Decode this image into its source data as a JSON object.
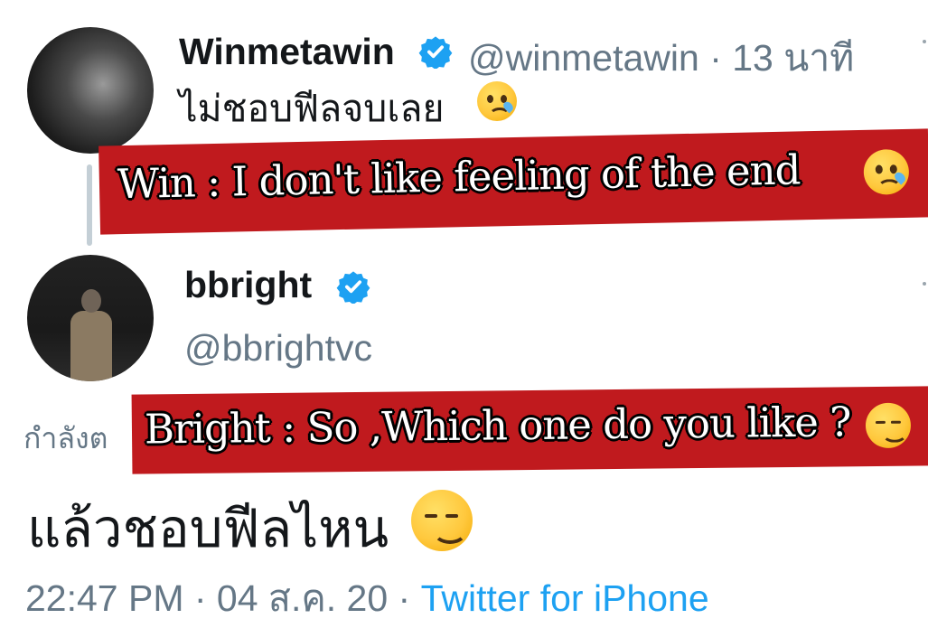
{
  "tweet_original": {
    "display_name": "Winmetawin",
    "handle": "@winmetawin",
    "meta": "@winmetawin · 13 นาที",
    "text": "ไม่ชอบฟีลจบเลย",
    "emoji": "crying-face"
  },
  "caption_win": {
    "text": "Win :  I don't like feeling of the end",
    "emoji": "crying-face"
  },
  "tweet_reply": {
    "display_name": "bbright",
    "handle": "@bbrightvc",
    "replying_to": "กำลังต",
    "text": "แล้วชอบฟีลไหน",
    "emoji": "smirking-face",
    "timestamp": "22:47 PM · 04 ส.ค. 20 · ",
    "source": "Twitter for iPhone"
  },
  "caption_bright": {
    "text": "Bright : So ,Which one do you like ?",
    "emoji": "smirking-face"
  },
  "colors": {
    "verified": "#1da1f2",
    "link": "#1da1f2",
    "secondary_text": "#657786",
    "banner": "#c01a1e",
    "thread_line": "#c4cfd6"
  },
  "icons": {
    "verified": "verified-badge-icon"
  }
}
